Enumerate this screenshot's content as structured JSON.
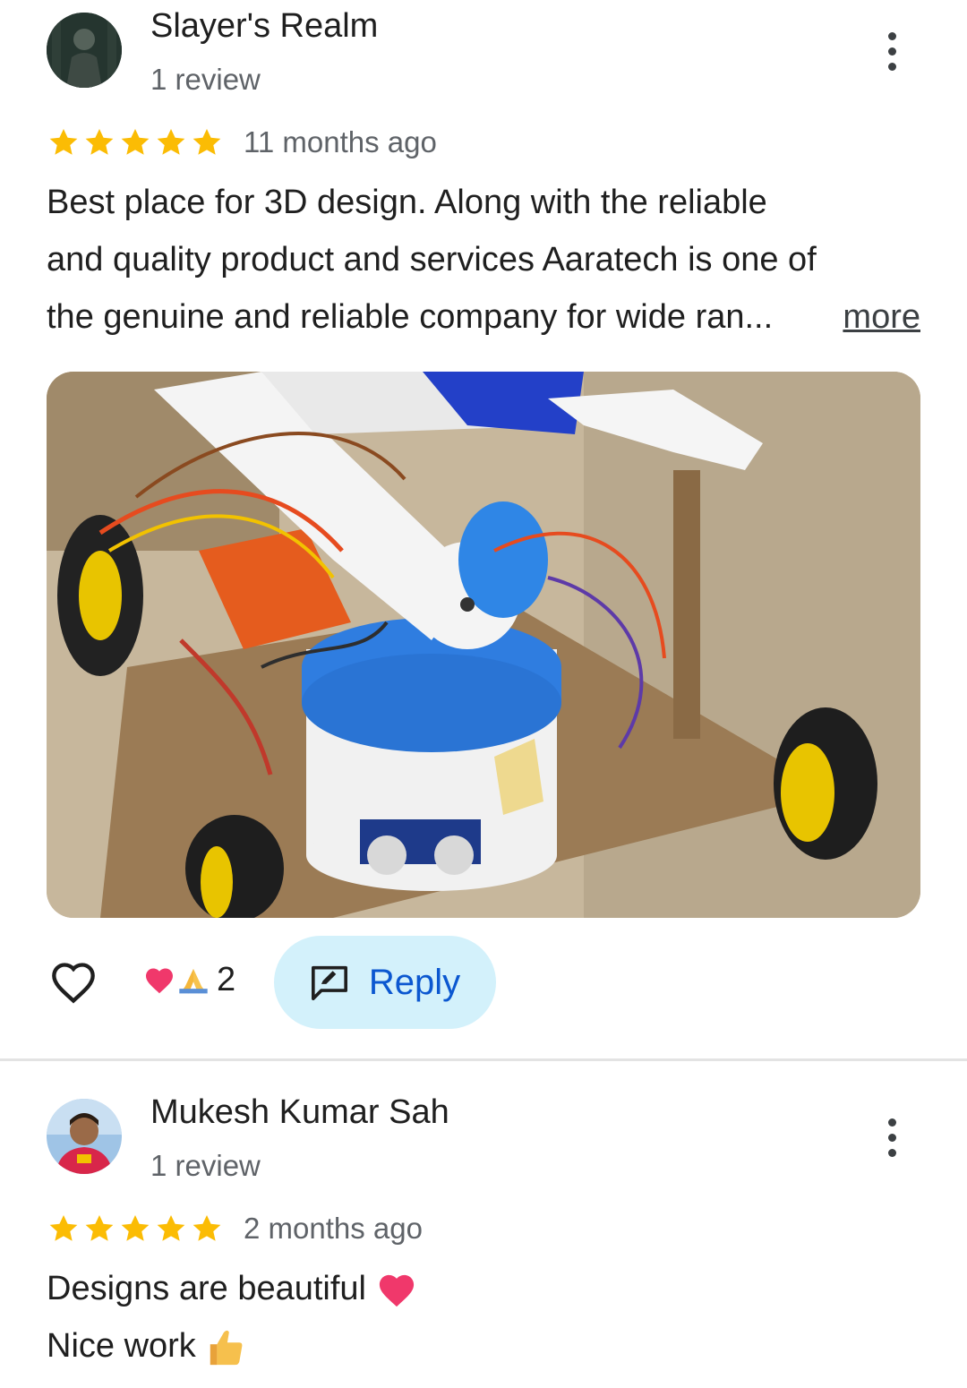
{
  "reviews": [
    {
      "author": "Slayer's Realm",
      "subtitle": "1 review",
      "rating": 5,
      "age": "11 months ago",
      "text_lines": [
        "Best place for 3D design. Along with the reliable",
        "and quality product and services Aaratech is one of",
        "the genuine and reliable company for wide ran..."
      ],
      "more_label": "more",
      "has_photo": true,
      "reaction_count": "2",
      "reply_label": "Reply"
    },
    {
      "author": "Mukesh Kumar Sah",
      "subtitle": "1 review",
      "rating": 5,
      "age": "2 months ago",
      "text_lines": [
        "Designs are beautiful",
        "Nice work"
      ]
    }
  ],
  "colors": {
    "star": "#fbbc04",
    "reply_bg": "#d3f1fb",
    "reply_text": "#0b57d0",
    "secondary_text": "#5f6368"
  },
  "icons": [
    "more-vert-icon",
    "star-icon",
    "heart-outline-icon",
    "reaction-heart-emoji",
    "reaction-pray-emoji",
    "reply-icon",
    "heart-emoji",
    "thumbs-up-emoji"
  ]
}
